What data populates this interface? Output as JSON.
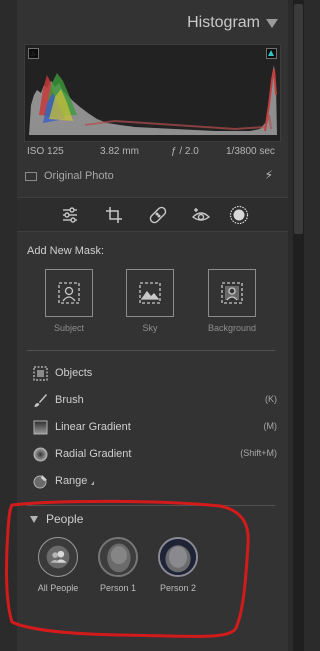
{
  "histogram": {
    "title": "Histogram",
    "exif": {
      "iso": "ISO 125",
      "focal": "3.82 mm",
      "aperture": "ƒ / 2.0",
      "shutter": "1/3800 sec"
    },
    "original_photo_label": "Original Photo"
  },
  "tools": [
    "edit-sliders-icon",
    "crop-icon",
    "healing-icon",
    "red-eye-icon",
    "masking-icon"
  ],
  "masking": {
    "add_new_title": "Add New Mask:",
    "quick": [
      {
        "label": "Subject",
        "icon": "subject-icon"
      },
      {
        "label": "Sky",
        "icon": "sky-icon"
      },
      {
        "label": "Background",
        "icon": "background-icon"
      }
    ],
    "tool_list": [
      {
        "label": "Objects",
        "shortcut": "",
        "icon": "objects-icon"
      },
      {
        "label": "Brush",
        "shortcut": "(K)",
        "icon": "brush-icon"
      },
      {
        "label": "Linear Gradient",
        "shortcut": "(M)",
        "icon": "linear-gradient-icon"
      },
      {
        "label": "Radial Gradient",
        "shortcut": "(Shift+M)",
        "icon": "radial-gradient-icon"
      },
      {
        "label": "Range",
        "shortcut": "",
        "icon": "range-icon"
      }
    ]
  },
  "people": {
    "title": "People",
    "items": [
      {
        "label": "All People",
        "icon": "all-people-icon"
      },
      {
        "label": "Person 1",
        "icon": "person-thumbnail"
      },
      {
        "label": "Person 2",
        "icon": "person-thumbnail"
      }
    ]
  },
  "colors": {
    "panel": "#333333",
    "background": "#2b2b2b",
    "clip_highlight": "#2ec7c2",
    "annotation_red": "#d41b1b"
  }
}
